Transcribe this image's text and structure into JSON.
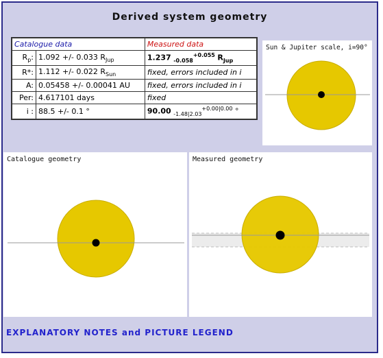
{
  "title": "Derived system geometry",
  "table": {
    "header_catalogue": "Catalogue data",
    "header_measured": "Measured data",
    "rows": [
      {
        "label": "R",
        "label_sub": "p",
        "label_suffix": ":",
        "cat_main": "1.092 +/- 0.033 R",
        "cat_sub": "Jup",
        "meas_main": "1.237",
        "meas_minus": "-0.058",
        "meas_plus": "+0.055",
        "meas_unit": "R",
        "meas_unit_sub": "Jup"
      },
      {
        "label": "R*:",
        "cat_main": "1.112 +/- 0.022 R",
        "cat_sub": "Sun",
        "meas_text": "fixed, errors included in i"
      },
      {
        "label": "A:",
        "cat_main": "0.05458 +/- 0.00041 AU",
        "meas_text": "fixed, errors included in i"
      },
      {
        "label": "Per:",
        "cat_main": "4.617101 days",
        "meas_text": "fixed"
      },
      {
        "label": "i :",
        "cat_main": "88.5 +/- 0.1 °",
        "meas_main": "90.00",
        "meas_minus": "-1.48|2.03",
        "meas_plus": "+0.00|0.00",
        "meas_unit": "°"
      }
    ]
  },
  "panels": {
    "scale_title": "Sun & Jupiter scale, i=90°",
    "catalogue_title": "Catalogue geometry",
    "measured_title": "Measured geometry"
  },
  "notes_link": "EXPLANATORY NOTES and PICTURE LEGEND",
  "colors": {
    "star": "#e6c800",
    "star_edge": "#c9ad00",
    "planet": "#000000",
    "background": "#cfcfe8",
    "link": "#2222cc"
  }
}
